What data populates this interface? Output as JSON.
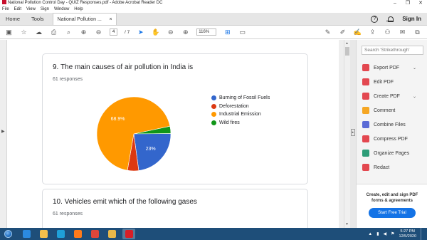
{
  "window": {
    "title": "National Pollution Control Day - QUIZ Responses.pdf - Adobe Acrobat Reader DC",
    "minimize": "–",
    "maximize": "❐",
    "close": "✕"
  },
  "menu": [
    "File",
    "Edit",
    "View",
    "Sign",
    "Window",
    "Help"
  ],
  "tabs": {
    "home": "Home",
    "tools": "Tools",
    "doc": "National Pollution ...",
    "close": "×",
    "help": "?",
    "signin": "Sign In"
  },
  "toolbar": {
    "page_current": "4",
    "page_total": "/ 7",
    "zoom": "116%"
  },
  "doc": {
    "q9": {
      "title": "9. The main causes of air pollution in India is",
      "responses": "61 responses"
    },
    "q10": {
      "title": "10. Vehicles emit which of the following gases",
      "responses": "61 responses"
    }
  },
  "chart_data": {
    "type": "pie",
    "series": [
      {
        "name": "Burning of Fossil Fuels",
        "value": 23,
        "color": "#3366cc",
        "label": "23%"
      },
      {
        "name": "Deforestation",
        "value": 4.9,
        "color": "#dc3912",
        "label": ""
      },
      {
        "name": "Industrial Emission",
        "value": 68.9,
        "color": "#ff9900",
        "label": "68.9%"
      },
      {
        "name": "Wild fires",
        "value": 3.2,
        "color": "#109618",
        "label": ""
      }
    ],
    "legend": "right"
  },
  "rightpane": {
    "search_placeholder": "Search 'Strikethrough'",
    "tools": [
      {
        "label": "Export PDF",
        "color": "#e34850",
        "chevron": "⌄"
      },
      {
        "label": "Edit PDF",
        "color": "#e34850",
        "chevron": ""
      },
      {
        "label": "Create PDF",
        "color": "#e34850",
        "chevron": "⌄"
      },
      {
        "label": "Comment",
        "color": "#f5a623",
        "chevron": ""
      },
      {
        "label": "Combine Files",
        "color": "#5b6bd6",
        "chevron": ""
      },
      {
        "label": "Compress PDF",
        "color": "#e34850",
        "chevron": ""
      },
      {
        "label": "Organize Pages",
        "color": "#2d9d78",
        "chevron": ""
      },
      {
        "label": "Redact",
        "color": "#e34850",
        "chevron": ""
      }
    ],
    "promo_line1": "Create, edit and sign PDF",
    "promo_line2": "forms & agreements",
    "promo_button": "Start Free Trial"
  },
  "taskbar": {
    "apps": [
      {
        "name": "ie",
        "color": "#2b8ae0"
      },
      {
        "name": "explorer",
        "color": "#f3c04c"
      },
      {
        "name": "edge",
        "color": "#1fa0d8"
      },
      {
        "name": "firefox",
        "color": "#ff7a1a"
      },
      {
        "name": "chrome",
        "color": "#e0463a"
      },
      {
        "name": "folder",
        "color": "#e7b84a"
      },
      {
        "name": "acrobat",
        "color": "#d81e27"
      }
    ],
    "time": "5:27 PM",
    "date": "12/5/2020"
  }
}
